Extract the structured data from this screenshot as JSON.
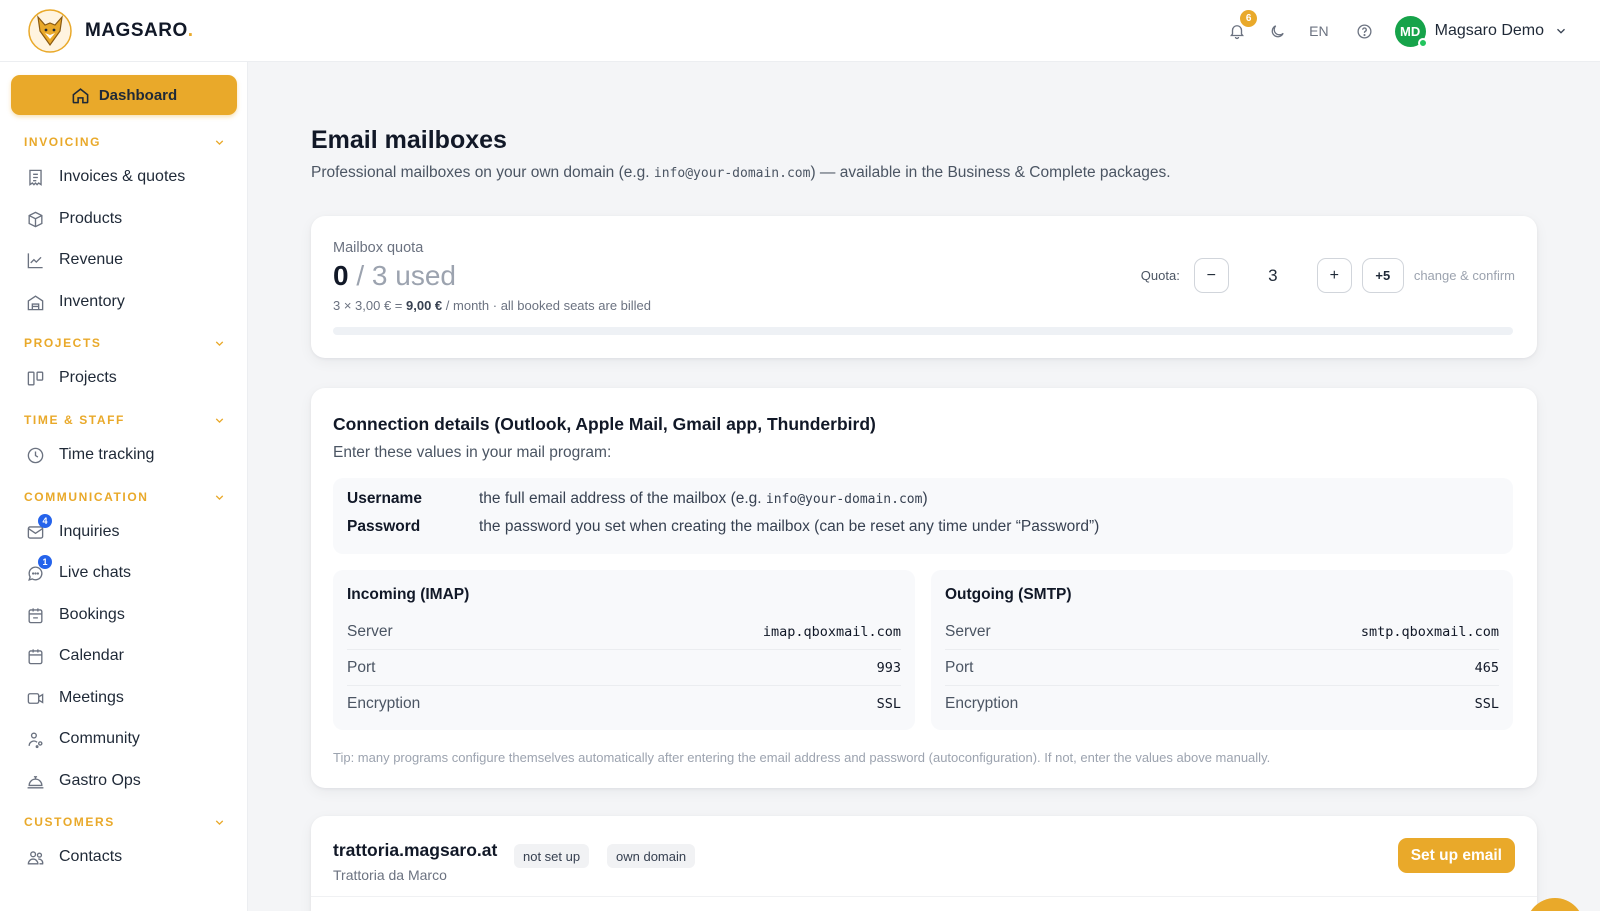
{
  "header": {
    "brand": "MAGSARO",
    "brand_dot": ".",
    "notification_count": "6",
    "language": "EN",
    "user_initials": "MD",
    "user_name": "Magsaro Demo"
  },
  "sidebar": {
    "dashboard": "Dashboard",
    "sections": {
      "invoicing": "INVOICING",
      "projects": "PROJECTS",
      "time_staff": "TIME & STAFF",
      "communication": "COMMUNICATION",
      "customers": "CUSTOMERS"
    },
    "items": {
      "invoices": "Invoices & quotes",
      "products": "Products",
      "revenue": "Revenue",
      "inventory": "Inventory",
      "projects": "Projects",
      "time_tracking": "Time tracking",
      "inquiries": "Inquiries",
      "inquiries_badge": "4",
      "live_chats": "Live chats",
      "live_chats_badge": "1",
      "bookings": "Bookings",
      "calendar": "Calendar",
      "meetings": "Meetings",
      "community": "Community",
      "gastro_ops": "Gastro Ops",
      "contacts": "Contacts"
    }
  },
  "page": {
    "title": "Email mailboxes",
    "subtitle_pre": "Professional mailboxes on your own domain (e.g. ",
    "subtitle_code": "info@your-domain.com",
    "subtitle_post": ") — available in the Business & Complete packages."
  },
  "quota": {
    "label": "Mailbox quota",
    "used": "0",
    "total_text": " / 3 used",
    "used_fraction": 0,
    "billing_pre": "3 × 3,00 € = ",
    "billing_total": "9,00 €",
    "billing_post": " / month · all booked seats are billed",
    "control_label": "Quota:",
    "minus": "−",
    "value": "3",
    "plus": "+",
    "plus_five": "+5",
    "confirm": "change & confirm"
  },
  "connection": {
    "title": "Connection details (Outlook, Apple Mail, Gmail app, Thunderbird)",
    "subtitle": "Enter these values in your mail program:",
    "username_label": "Username",
    "username_pre": "the full email address of the mailbox (e.g. ",
    "username_code": "info@your-domain.com",
    "username_post": ")",
    "password_label": "Password",
    "password_value": "the password you set when creating the mailbox (can be reset any time under “Password”)",
    "incoming": {
      "title": "Incoming (IMAP)",
      "server_label": "Server",
      "server": "imap.qboxmail.com",
      "port_label": "Port",
      "port": "993",
      "enc_label": "Encryption",
      "enc": "SSL"
    },
    "outgoing": {
      "title": "Outgoing (SMTP)",
      "server_label": "Server",
      "server": "smtp.qboxmail.com",
      "port_label": "Port",
      "port": "465",
      "enc_label": "Encryption",
      "enc": "SSL"
    },
    "tip": "Tip: many programs configure themselves automatically after entering the email address and password (autoconfiguration). If not, enter the values above manually."
  },
  "domain": {
    "name": "trattoria.magsaro.at",
    "business": "Trattoria da Marco",
    "tag_status": "not set up",
    "tag_type": "own domain",
    "setup_button": "Set up email"
  },
  "colors": {
    "accent": "#e9a92a",
    "badge_blue": "#2563eb",
    "avatar_green": "#16a34a"
  }
}
